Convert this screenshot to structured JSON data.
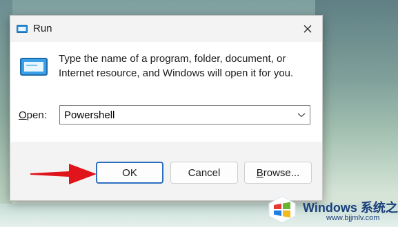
{
  "dialog": {
    "title": "Run",
    "description": "Type the name of a program, folder, document, or Internet resource, and Windows will open it for you.",
    "open_label_underlined": "O",
    "open_label_rest": "pen:",
    "open_value": "Powershell",
    "buttons": {
      "ok": "OK",
      "cancel": "Cancel",
      "browse_underlined": "B",
      "browse_rest": "rowse..."
    }
  },
  "watermark": {
    "name": "Windows 系统之家",
    "url": "www.bjjmlv.com"
  },
  "icons": [
    "run-app-icon",
    "close-icon",
    "chevron-down-icon",
    "red-arrow-icon",
    "windows-logo-icon"
  ],
  "colors": {
    "ok_border": "#2c6fbf",
    "arrow": "#e0141a",
    "watermark_text": "#1b3f7a"
  }
}
